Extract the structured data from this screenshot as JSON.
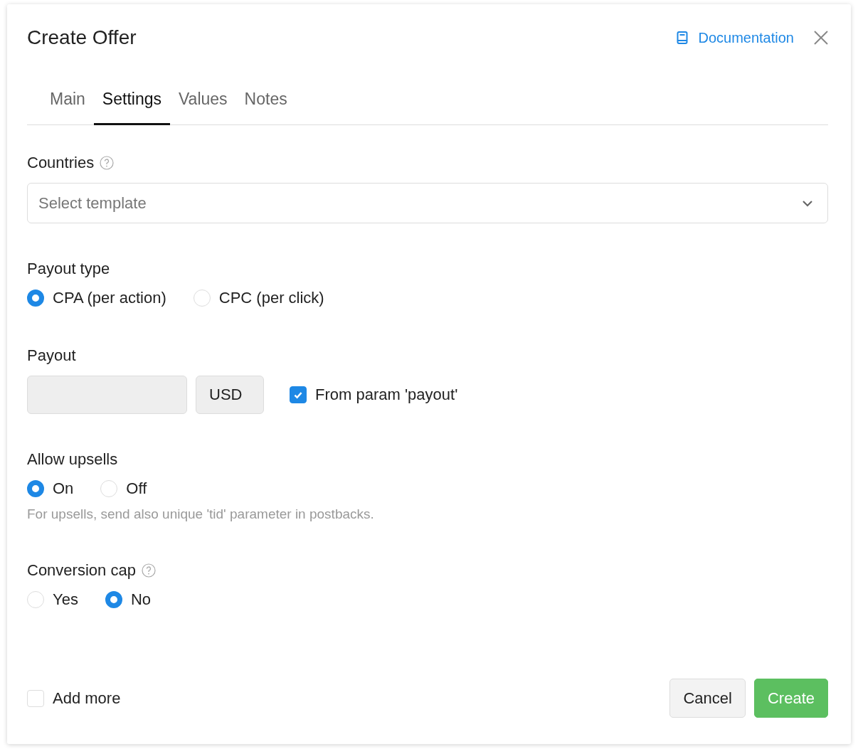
{
  "dialog": {
    "title": "Create Offer",
    "documentation_link": "Documentation"
  },
  "tabs": [
    {
      "label": "Main",
      "selected": false
    },
    {
      "label": "Settings",
      "selected": true
    },
    {
      "label": "Values",
      "selected": false
    },
    {
      "label": "Notes",
      "selected": false
    }
  ],
  "countries": {
    "label": "Countries",
    "help": true,
    "placeholder": "Select template"
  },
  "payout_type": {
    "label": "Payout type",
    "options": [
      {
        "label": "CPA (per action)",
        "selected": true
      },
      {
        "label": "CPC (per click)",
        "selected": false
      }
    ]
  },
  "payout": {
    "label": "Payout",
    "disabled": true,
    "currency": "USD",
    "from_param": {
      "label": "From param 'payout'",
      "checked": true
    }
  },
  "allow_upsells": {
    "label": "Allow upsells",
    "options": [
      {
        "label": "On",
        "selected": true
      },
      {
        "label": "Off",
        "selected": false
      }
    ],
    "hint": "For upsells, send also unique 'tid' parameter in postbacks."
  },
  "conversion_cap": {
    "label": "Conversion cap",
    "help": true,
    "options": [
      {
        "label": "Yes",
        "selected": false
      },
      {
        "label": "No",
        "selected": true
      }
    ]
  },
  "footer": {
    "add_more": {
      "label": "Add more",
      "checked": false
    },
    "buttons": [
      {
        "label": "Cancel",
        "kind": "secondary"
      },
      {
        "label": "Create",
        "kind": "primary"
      }
    ]
  }
}
